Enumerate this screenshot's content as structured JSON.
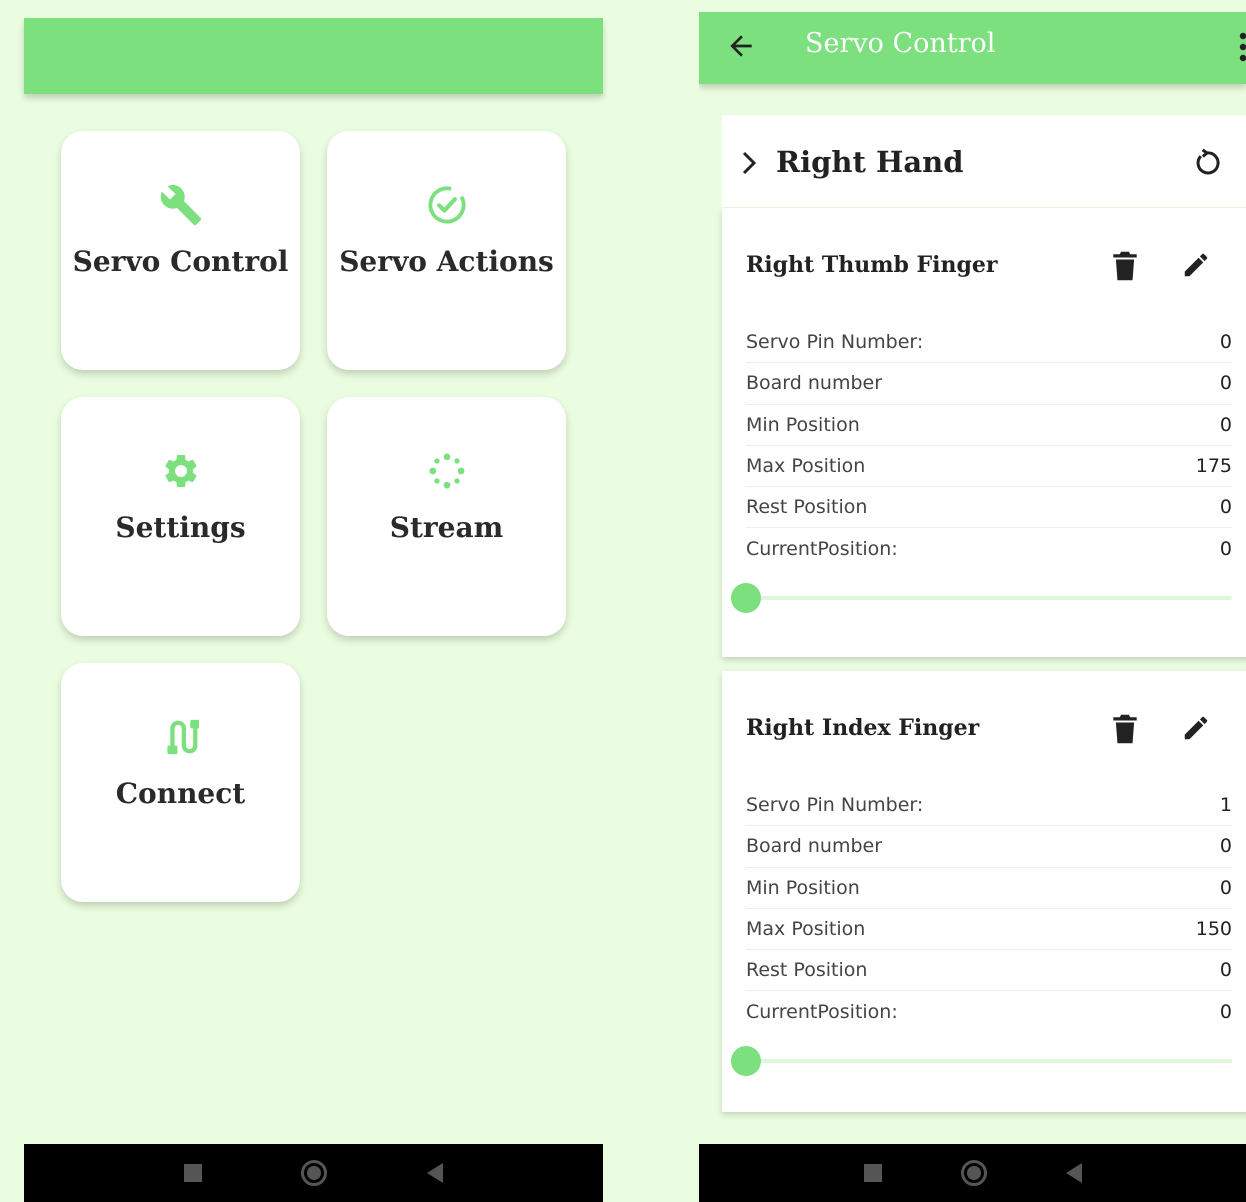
{
  "home": {
    "tiles": [
      {
        "label": "Servo Control",
        "icon": "wrench-icon"
      },
      {
        "label": "Servo Actions",
        "icon": "check-circle-icon"
      },
      {
        "label": "Settings",
        "icon": "gear-icon"
      },
      {
        "label": "Stream",
        "icon": "spinner-icon"
      },
      {
        "label": "Connect",
        "icon": "cable-icon"
      }
    ]
  },
  "servo_control": {
    "title": "Servo Control",
    "group": {
      "name": "Right Hand"
    },
    "cards": [
      {
        "name": "Right Thumb Finger",
        "rows": [
          {
            "label": "Servo Pin Number:",
            "value": "0"
          },
          {
            "label": "Board number",
            "value": "0"
          },
          {
            "label": "Min Position",
            "value": "0"
          },
          {
            "label": "Max Position",
            "value": "175"
          },
          {
            "label": "Rest Position",
            "value": "0"
          },
          {
            "label": "CurrentPosition:",
            "value": "0"
          }
        ],
        "slider": {
          "value": 0,
          "min": 0,
          "max": 175
        }
      },
      {
        "name": "Right Index Finger",
        "rows": [
          {
            "label": "Servo Pin Number:",
            "value": "1"
          },
          {
            "label": "Board number",
            "value": "0"
          },
          {
            "label": "Min Position",
            "value": "0"
          },
          {
            "label": "Max Position",
            "value": "150"
          },
          {
            "label": "Rest Position",
            "value": "0"
          },
          {
            "label": "CurrentPosition:",
            "value": "0"
          }
        ],
        "slider": {
          "value": 0,
          "min": 0,
          "max": 150
        }
      }
    ]
  },
  "colors": {
    "accent": "#7be07d",
    "background": "#ebfde0",
    "navbar": "#000000"
  },
  "nav_icons": [
    "recents-square-icon",
    "home-circle-icon",
    "back-triangle-icon"
  ]
}
